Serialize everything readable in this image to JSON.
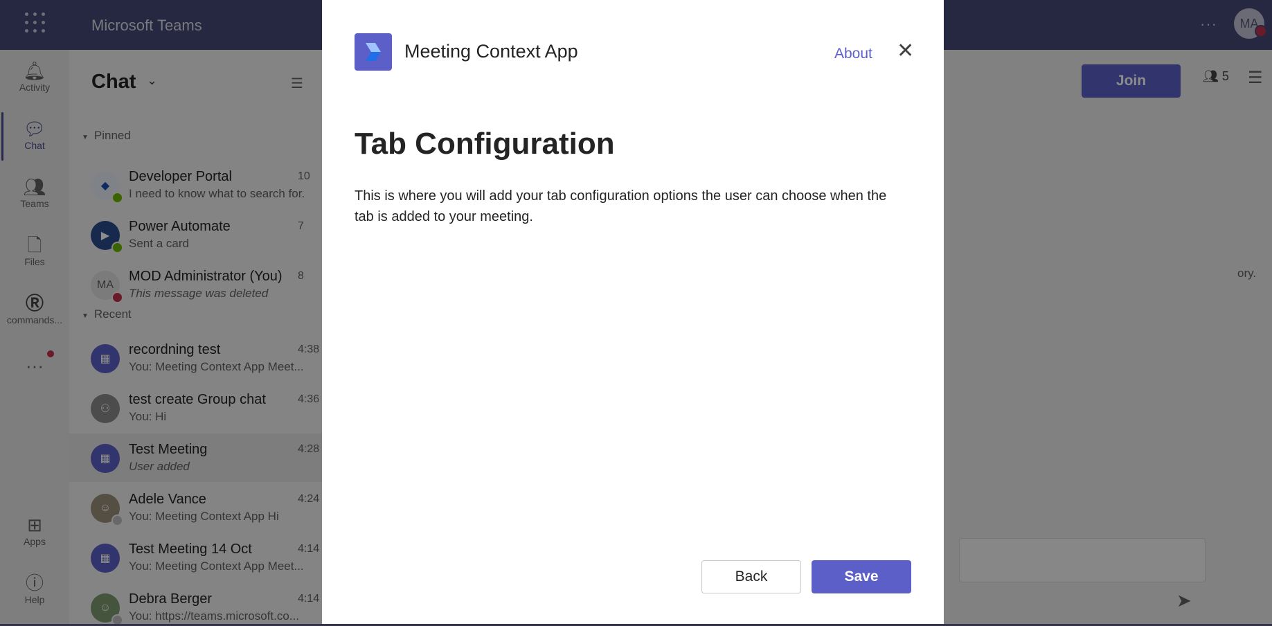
{
  "header": {
    "app_name": "Microsoft Teams",
    "more": "···",
    "avatar_initials": "MA"
  },
  "rail": {
    "items": [
      {
        "label": "Activity",
        "icon": "bell-icon"
      },
      {
        "label": "Chat",
        "icon": "chat-icon",
        "active": true
      },
      {
        "label": "Teams",
        "icon": "teams-icon"
      },
      {
        "label": "Files",
        "icon": "file-icon"
      },
      {
        "label": "commands...",
        "icon": "app-r-icon"
      },
      {
        "label": "Apps",
        "icon": "apps-grid-icon"
      },
      {
        "label": "Help",
        "icon": "help-icon"
      }
    ],
    "more": "···"
  },
  "chatlist": {
    "title": "Chat",
    "sections": {
      "pinned": "Pinned",
      "recent": "Recent"
    },
    "pinned": [
      {
        "name": "Developer Portal",
        "preview": "I need to know what to search for.",
        "time": "10"
      },
      {
        "name": "Power Automate",
        "preview": "Sent a card",
        "time": "7"
      },
      {
        "name": "MOD Administrator (You)",
        "preview": "This message was deleted",
        "time": "8",
        "avatar": "MA"
      }
    ],
    "recent": [
      {
        "name": "recordning test",
        "preview": "You: Meeting Context App Meet...",
        "time": "4:38"
      },
      {
        "name": "test create Group chat",
        "preview": "You: Hi",
        "time": "4:36"
      },
      {
        "name": "Test Meeting",
        "preview": "User added",
        "time": "4:28"
      },
      {
        "name": "Adele Vance",
        "preview": "You: Meeting Context App Hi",
        "time": "4:24"
      },
      {
        "name": "Test Meeting 14 Oct",
        "preview": "You: Meeting Context App Meet...",
        "time": "4:14"
      },
      {
        "name": "Debra Berger",
        "preview": "You: https://teams.microsoft.co...",
        "time": "4:14"
      }
    ]
  },
  "main": {
    "join_label": "Join",
    "participant_count": "5",
    "background_text": "ory."
  },
  "dialog": {
    "app_name": "Meeting Context App",
    "about": "About",
    "close": "✕",
    "heading": "Tab Configuration",
    "body": "This is where you will add your tab configuration options the user can choose when the tab is added to your meeting.",
    "back_label": "Back",
    "save_label": "Save"
  },
  "colors": {
    "accent": "#5b5fc7",
    "header": "#464775",
    "busy": "#c4314b",
    "available": "#6bb700"
  }
}
